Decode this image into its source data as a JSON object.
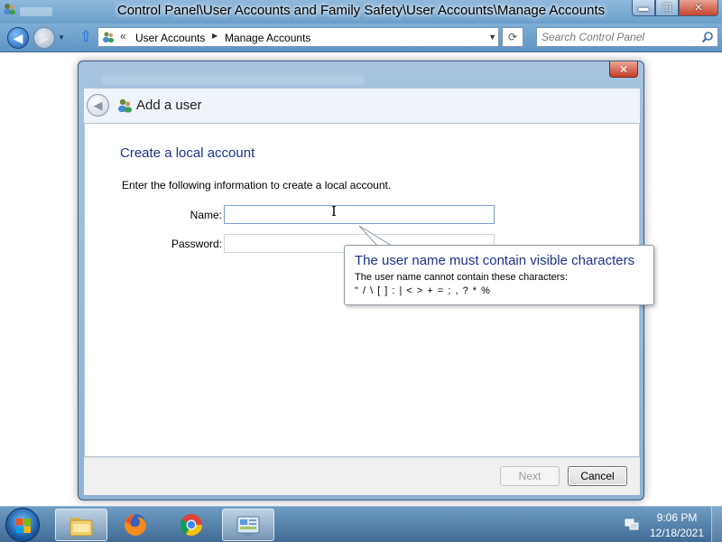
{
  "window": {
    "title": "Control Panel\\User Accounts and Family Safety\\User Accounts\\Manage Accounts",
    "minimize_glyph": "▬",
    "maximize_glyph": "❐",
    "close_glyph": "✕"
  },
  "navigation": {
    "back_icon": "left-arrow-icon",
    "forward_icon": "right-arrow-icon",
    "up_icon": "up-arrow-icon",
    "breadcrumb": [
      "User Accounts",
      "Manage Accounts"
    ],
    "breadcrumb_overflow": "«",
    "refresh_icon": "refresh-icon",
    "search_placeholder": "Search Control Panel"
  },
  "dialog": {
    "title": "Add a user",
    "section_title": "Create a local account",
    "instructions": "Enter the following information to create a local account.",
    "name_label": "Name:",
    "name_value": "",
    "password_label": "Password:",
    "password_value": "",
    "next_label": "Next",
    "cancel_label": "Cancel",
    "next_enabled": false
  },
  "balloon": {
    "title": "The user name must contain visible characters",
    "line1": "The user name cannot contain these characters:",
    "line2": "\" / \\ [ ] : | < > + = ; , ? * %"
  },
  "taskbar": {
    "pinned": [
      {
        "name": "Windows Explorer",
        "icon": "folder-icon",
        "active": true
      },
      {
        "name": "Firefox",
        "icon": "firefox-icon",
        "active": false
      },
      {
        "name": "Chrome",
        "icon": "chrome-icon",
        "active": false
      },
      {
        "name": "Control Panel",
        "icon": "control-panel-icon",
        "active": true
      }
    ],
    "clock": {
      "time": "9:06 PM",
      "date": "12/18/2021"
    }
  },
  "colors": {
    "accent_blue": "#1e3287",
    "window_frame": "#8fb1d3",
    "taskbar": "#3f6b95",
    "close_red": "#c43f29"
  }
}
